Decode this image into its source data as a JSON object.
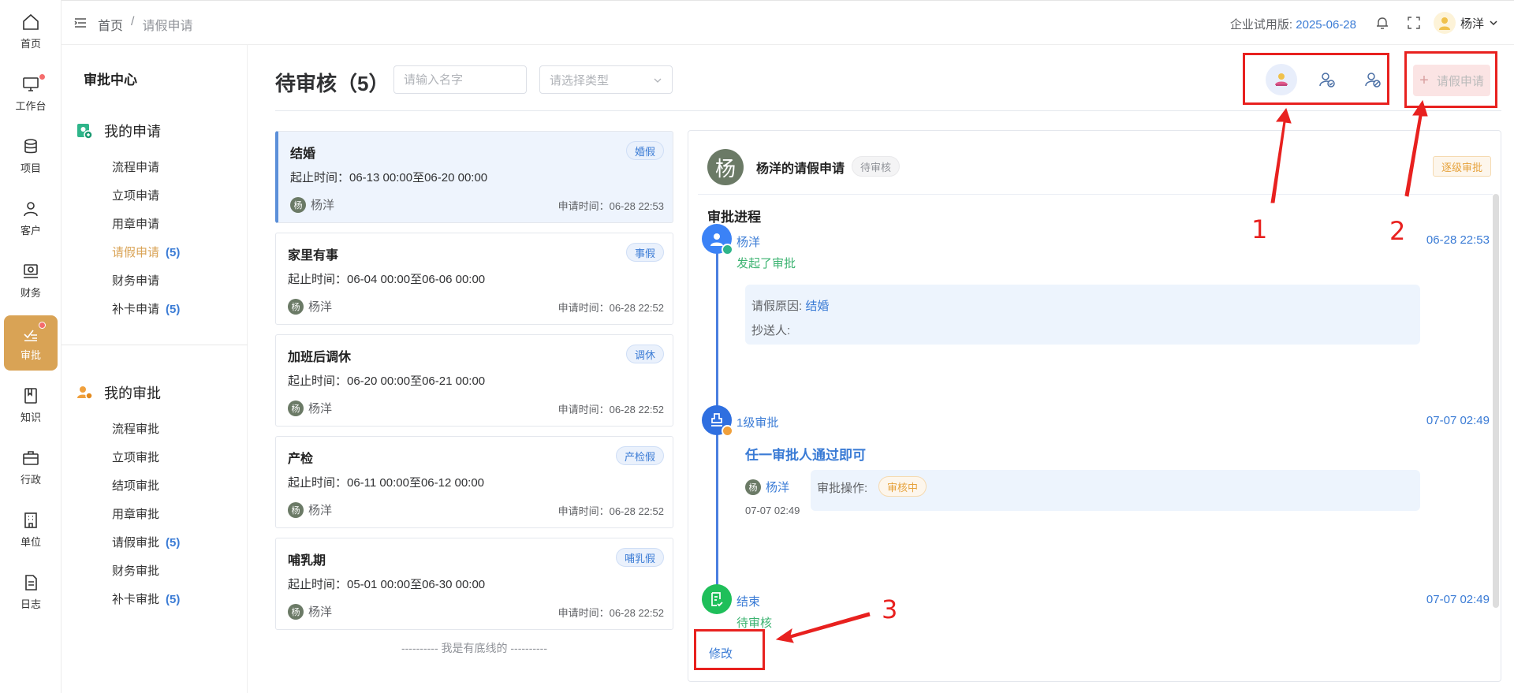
{
  "rail": {
    "items": [
      {
        "label": "首页",
        "icon": "home-icon"
      },
      {
        "label": "工作台",
        "icon": "monitor-icon"
      },
      {
        "label": "项目",
        "icon": "database-icon"
      },
      {
        "label": "客户",
        "icon": "user-icon"
      },
      {
        "label": "财务",
        "icon": "finance-icon"
      },
      {
        "label": "审批",
        "icon": "approval-icon"
      },
      {
        "label": "知识",
        "icon": "book-icon"
      },
      {
        "label": "行政",
        "icon": "briefcase-icon"
      },
      {
        "label": "单位",
        "icon": "building-icon"
      },
      {
        "label": "日志",
        "icon": "document-icon"
      }
    ],
    "active_color": "#d9a355"
  },
  "topbar": {
    "breadcrumb_home": "首页",
    "breadcrumb_sep": "/",
    "breadcrumb_current": "请假申请",
    "trial_label": "企业试用版:",
    "trial_date": "2025-06-28",
    "username": "杨洋"
  },
  "subside": {
    "title": "审批中心",
    "my_apply": {
      "label": "我的申请",
      "items": [
        {
          "label": "流程申请",
          "count": ""
        },
        {
          "label": "立项申请",
          "count": ""
        },
        {
          "label": "用章申请",
          "count": ""
        },
        {
          "label": "请假申请",
          "count": "(5)"
        },
        {
          "label": "财务申请",
          "count": ""
        },
        {
          "label": "补卡申请",
          "count": "(5)"
        }
      ]
    },
    "my_approve": {
      "label": "我的审批",
      "items": [
        {
          "label": "流程审批",
          "count": ""
        },
        {
          "label": "立项审批",
          "count": ""
        },
        {
          "label": "结项审批",
          "count": ""
        },
        {
          "label": "用章审批",
          "count": ""
        },
        {
          "label": "请假审批",
          "count": "(5)"
        },
        {
          "label": "财务审批",
          "count": ""
        },
        {
          "label": "补卡审批",
          "count": "(5)"
        }
      ]
    }
  },
  "main": {
    "title": "待审核（5）",
    "name_placeholder": "请输入名字",
    "type_placeholder": "请选择类型",
    "apply_button": "请假申请",
    "list_end": "---------- 我是有底线的 ----------"
  },
  "requests": [
    {
      "title": "结婚",
      "tag": "婚假",
      "range": "起止时间：06-13 00:00至06-20 00:00",
      "avatar": "杨",
      "user": "杨洋",
      "time": "申请时间：06-28 22:53"
    },
    {
      "title": "家里有事",
      "tag": "事假",
      "range": "起止时间：06-04 00:00至06-06 00:00",
      "avatar": "杨",
      "user": "杨洋",
      "time": "申请时间：06-28 22:52"
    },
    {
      "title": "加班后调休",
      "tag": "调休",
      "range": "起止时间：06-20 00:00至06-21 00:00",
      "avatar": "杨",
      "user": "杨洋",
      "time": "申请时间：06-28 22:52"
    },
    {
      "title": "产检",
      "tag": "产检假",
      "range": "起止时间：06-11 00:00至06-12 00:00",
      "avatar": "杨",
      "user": "杨洋",
      "time": "申请时间：06-28 22:52"
    },
    {
      "title": "哺乳期",
      "tag": "哺乳假",
      "range": "起止时间：05-01 00:00至06-30 00:00",
      "avatar": "杨",
      "user": "杨洋",
      "time": "申请时间：06-28 22:52"
    }
  ],
  "detail": {
    "avatar": "杨",
    "title": "杨洋的请假申请",
    "status": "待审核",
    "mode": "逐级审批",
    "progress_title": "审批进程",
    "start": {
      "name": "杨洋",
      "sub": "发起了审批",
      "time": "06-28 22:53"
    },
    "reason_label": "请假原因:",
    "reason_value": "结婚",
    "cc_label": "抄送人:",
    "level1": {
      "name": "1级审批",
      "time": "07-07 02:49",
      "rule": "任一审批人通过即可"
    },
    "approver": {
      "avatar": "杨",
      "name": "杨洋",
      "time": "07-07 02:49",
      "op_label": "审批操作:",
      "op_status": "审核中"
    },
    "end": {
      "name": "结束",
      "sub": "待审核",
      "time": "07-07 02:49"
    },
    "edit_link": "修改"
  },
  "annotations": {
    "n1": "1",
    "n2": "2",
    "n3": "3",
    "color": "#e8211f"
  }
}
